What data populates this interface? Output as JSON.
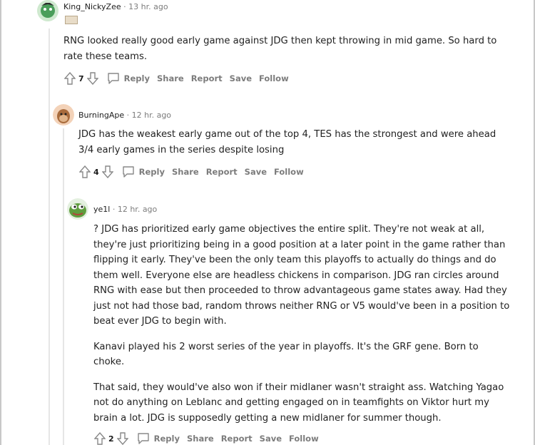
{
  "comments": [
    {
      "username": "King_NickyZee",
      "separator": "·",
      "time": "13 hr. ago",
      "flair_text": "",
      "paragraphs": [
        "RNG looked really good early game against JDG then kept throwing in mid game. So hard to rate these teams."
      ],
      "score": "7",
      "actions": {
        "reply": "Reply",
        "share": "Share",
        "report": "Report",
        "save": "Save",
        "follow": "Follow"
      }
    },
    {
      "username": "BurningApe",
      "separator": "·",
      "time": "12 hr. ago",
      "paragraphs": [
        "JDG has the weakest early game out of the top 4, TES has the strongest and were ahead 3/4 early games in the series despite losing"
      ],
      "score": "4",
      "actions": {
        "reply": "Reply",
        "share": "Share",
        "report": "Report",
        "save": "Save",
        "follow": "Follow"
      }
    },
    {
      "username": "ye1l",
      "separator": "·",
      "time": "12 hr. ago",
      "paragraphs": [
        "? JDG has prioritized early game objectives the entire split. They're not weak at all, they're just prioritizing being in a good position at a later point in the game rather than flipping it early. They've been the only team this playoffs to actually do things and do them well. Everyone else are headless chickens in comparison. JDG ran circles around RNG with ease but then proceeded to throw advantageous game states away. Had they just not had those bad, random throws neither RNG or V5 would've been in a position to beat ever JDG to begin with.",
        "Kanavi played his 2 worst series of the year in playoffs. It's the GRF gene. Born to choke.",
        "That said, they would've also won if their midlaner wasn't straight ass. Watching Yagao not do anything on Leblanc and getting engaged on in teamfights on Viktor hurt my brain a lot. JDG is supposedly getting a new midlaner for summer though."
      ],
      "score": "2",
      "actions": {
        "reply": "Reply",
        "share": "Share",
        "report": "Report",
        "save": "Save",
        "follow": "Follow"
      }
    }
  ],
  "colors": {
    "text": "#222222",
    "muted": "#7c7c7c",
    "thread": "#e6e6e6"
  }
}
